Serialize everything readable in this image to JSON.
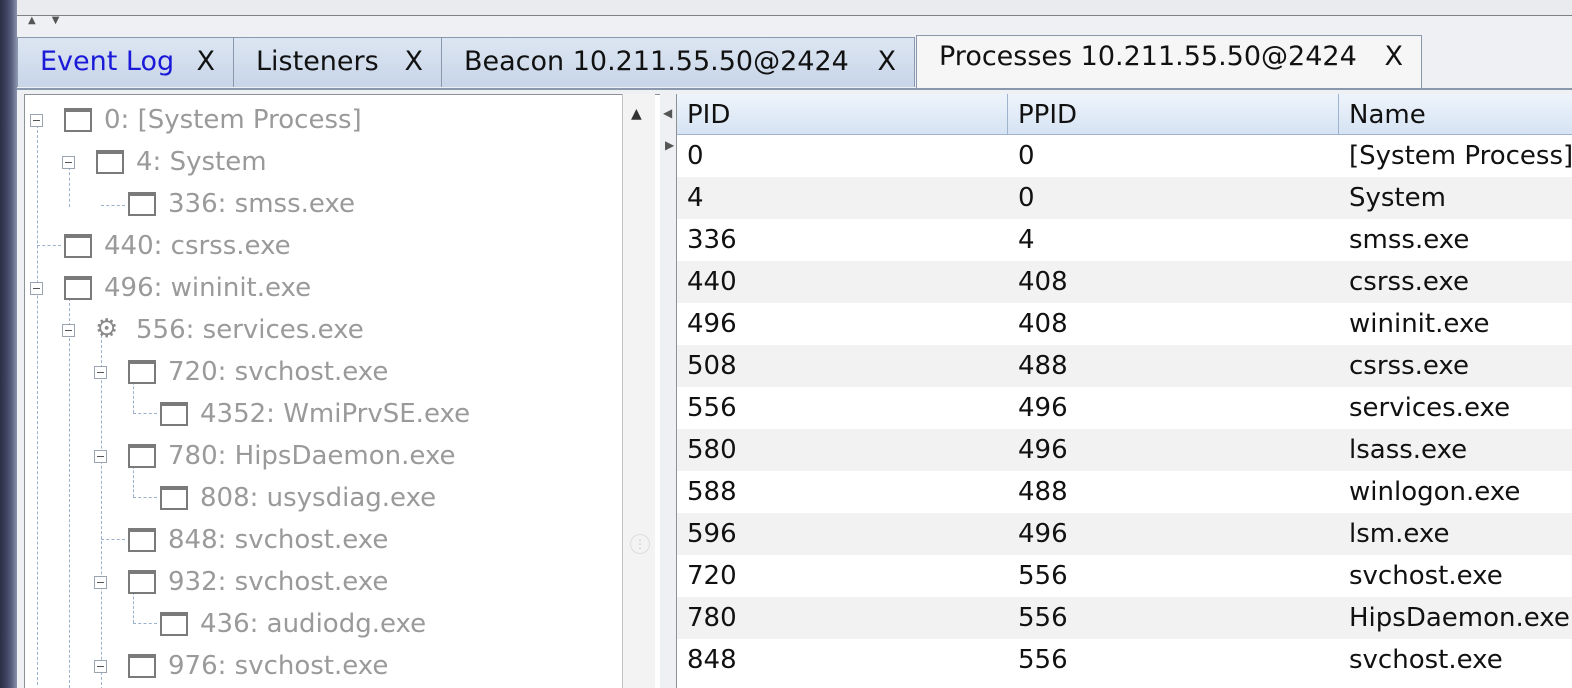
{
  "tabs": [
    {
      "label": "Event Log",
      "close": "X"
    },
    {
      "label": "Listeners",
      "close": "X"
    },
    {
      "label": "Beacon 10.211.55.50@2424",
      "close": "X"
    },
    {
      "label": "Processes 10.211.55.50@2424",
      "close": "X"
    }
  ],
  "tree": {
    "nodes": [
      {
        "label": "0: [System Process]",
        "depth": 0,
        "expanded": true,
        "icon": "window-icon"
      },
      {
        "label": "4: System",
        "depth": 1,
        "expanded": true,
        "icon": "window-icon"
      },
      {
        "label": "336: smss.exe",
        "depth": 2,
        "icon": "window-icon"
      },
      {
        "label": "440: csrss.exe",
        "depth": 0,
        "icon": "window-icon"
      },
      {
        "label": "496: wininit.exe",
        "depth": 0,
        "expanded": true,
        "icon": "window-icon"
      },
      {
        "label": "556: services.exe",
        "depth": 1,
        "expanded": true,
        "icon": "gear-icon"
      },
      {
        "label": "720: svchost.exe",
        "depth": 2,
        "expanded": true,
        "icon": "window-icon"
      },
      {
        "label": "4352: WmiPrvSE.exe",
        "depth": 3,
        "icon": "window-icon"
      },
      {
        "label": "780: HipsDaemon.exe",
        "depth": 2,
        "expanded": true,
        "icon": "window-icon"
      },
      {
        "label": "808: usysdiag.exe",
        "depth": 3,
        "icon": "window-icon"
      },
      {
        "label": "848: svchost.exe",
        "depth": 2,
        "icon": "window-icon"
      },
      {
        "label": "932: svchost.exe",
        "depth": 2,
        "expanded": true,
        "icon": "window-icon"
      },
      {
        "label": "436: audiodg.exe",
        "depth": 3,
        "icon": "window-icon"
      },
      {
        "label": "976: svchost.exe",
        "depth": 2,
        "expanded": true,
        "icon": "window-icon"
      }
    ]
  },
  "table": {
    "columns": [
      "PID",
      "PPID",
      "Name"
    ],
    "rows": [
      [
        "0",
        "0",
        "[System Process]"
      ],
      [
        "4",
        "0",
        "System"
      ],
      [
        "336",
        "4",
        "smss.exe"
      ],
      [
        "440",
        "408",
        "csrss.exe"
      ],
      [
        "496",
        "408",
        "wininit.exe"
      ],
      [
        "508",
        "488",
        "csrss.exe"
      ],
      [
        "556",
        "496",
        "services.exe"
      ],
      [
        "580",
        "496",
        "lsass.exe"
      ],
      [
        "588",
        "488",
        "winlogon.exe"
      ],
      [
        "596",
        "496",
        "lsm.exe"
      ],
      [
        "720",
        "556",
        "svchost.exe"
      ],
      [
        "780",
        "556",
        "HipsDaemon.exe"
      ],
      [
        "848",
        "556",
        "svchost.exe"
      ]
    ]
  },
  "colors": {
    "active_link": "#1a1ad8",
    "tree_text": "#9a9a9a",
    "header_bg": "#d6e3f3"
  }
}
